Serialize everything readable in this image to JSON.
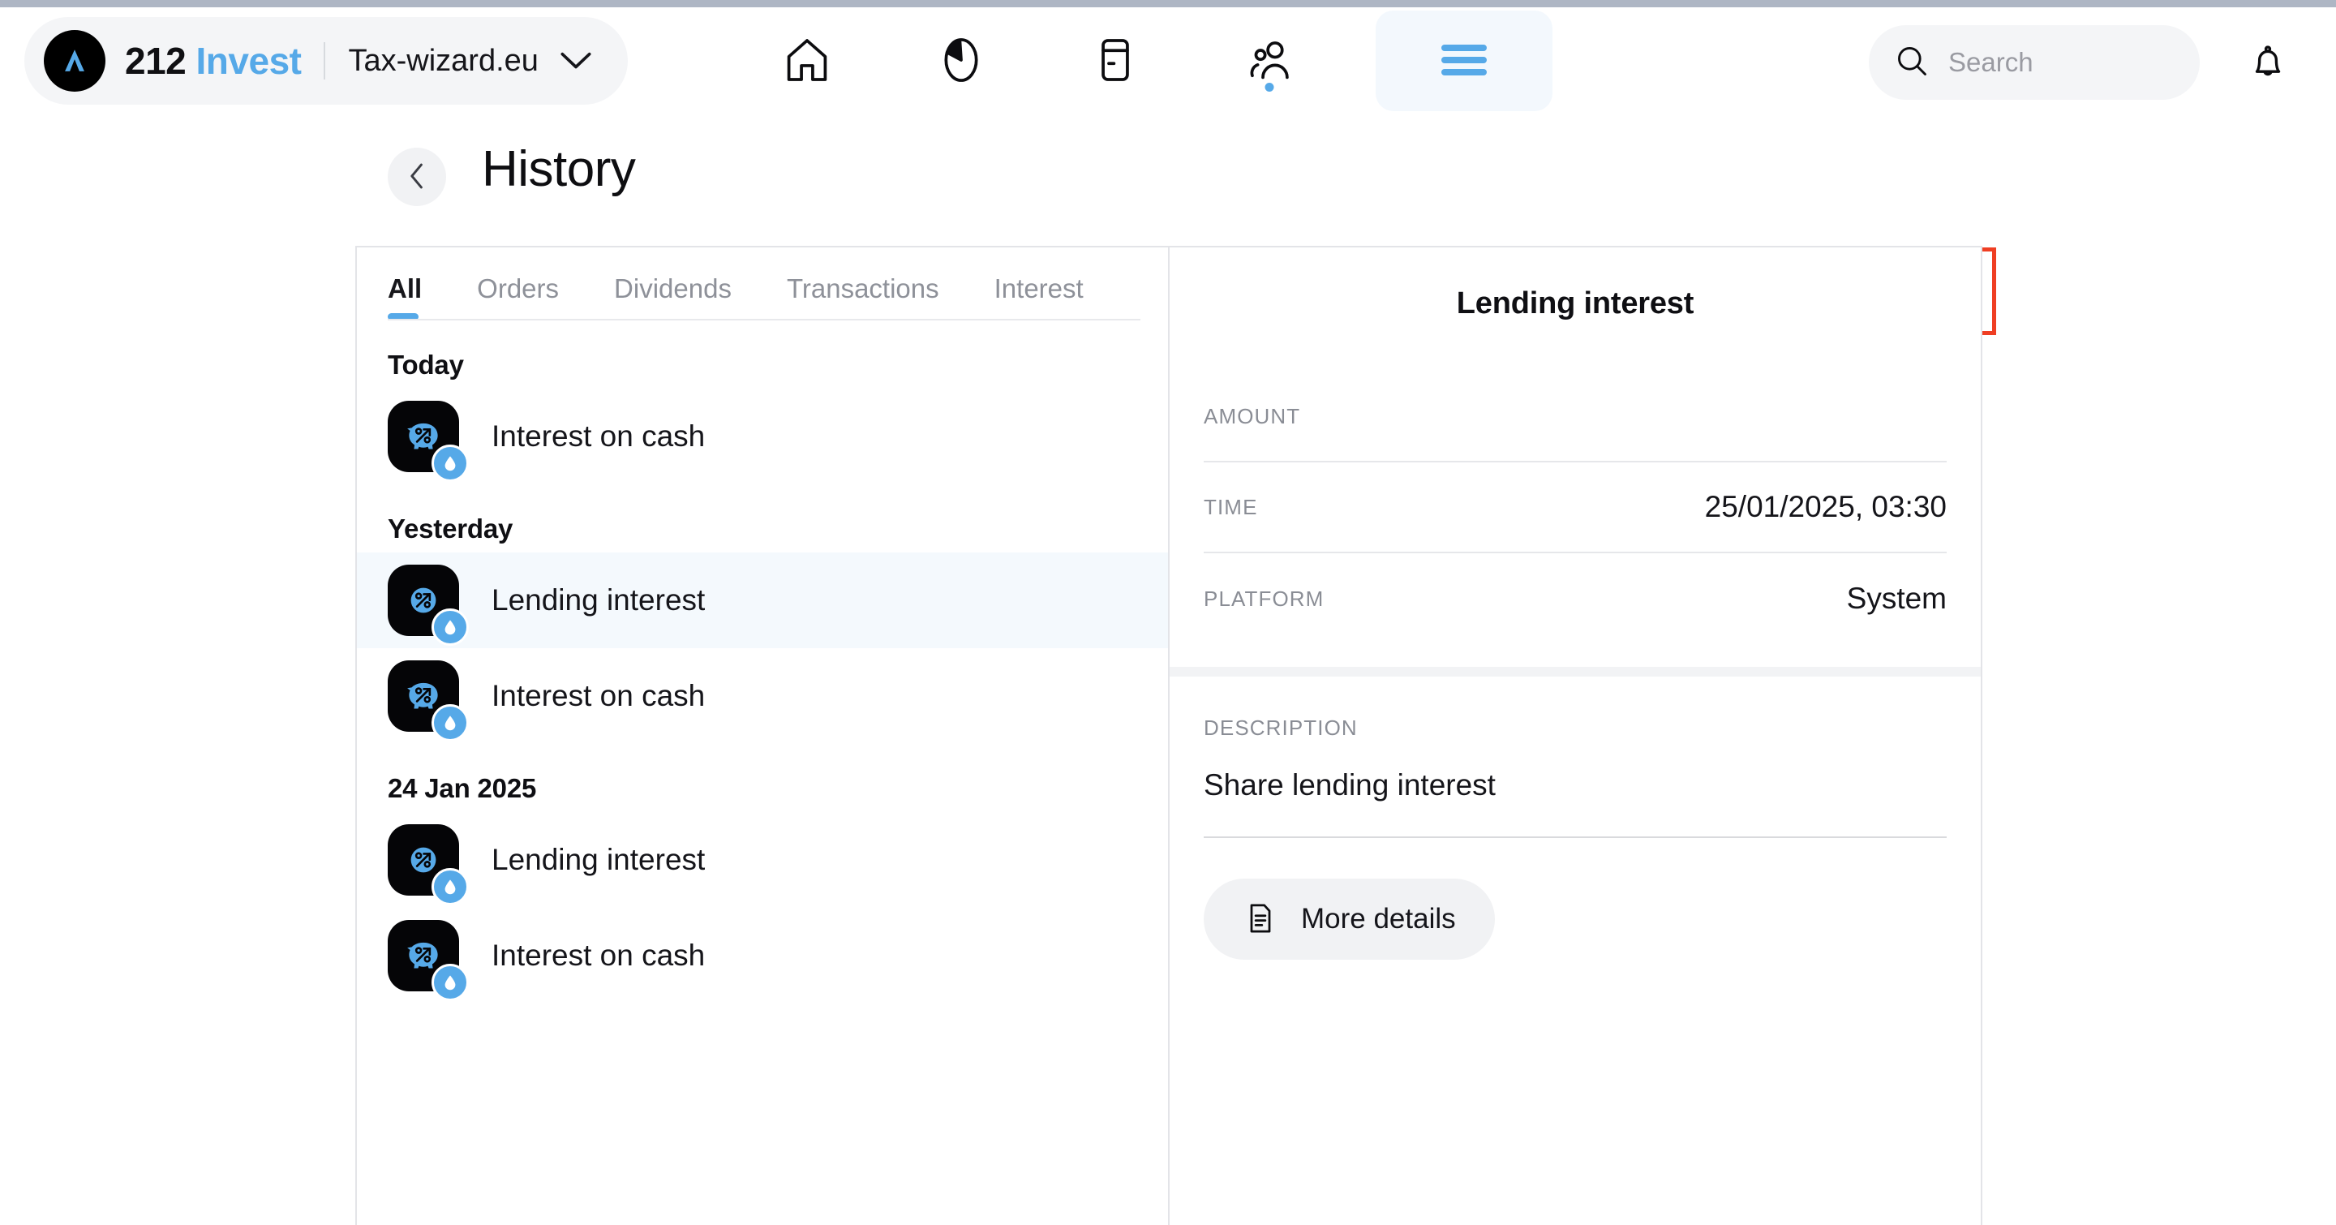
{
  "brand": {
    "logo_icon": "triangle-a-logo-icon",
    "name_prefix": "212",
    "name_accent": "Invest",
    "account": "Tax-wizard.eu",
    "caret_icon": "chevron-down-icon"
  },
  "nav": {
    "items": [
      {
        "name": "home-icon",
        "label": "Home",
        "active": false,
        "dot": false
      },
      {
        "name": "pie-chart-icon",
        "label": "Portfolio",
        "active": false,
        "dot": false
      },
      {
        "name": "card-icon",
        "label": "Card",
        "active": false,
        "dot": false
      },
      {
        "name": "people-icon",
        "label": "Community",
        "active": false,
        "dot": true
      },
      {
        "name": "hamburger-menu-icon",
        "label": "Menu",
        "active": true,
        "dot": false
      }
    ]
  },
  "search": {
    "placeholder": "Search",
    "value": "",
    "icon": "search-icon"
  },
  "notifications": {
    "icon": "bell-icon"
  },
  "page": {
    "back_icon": "chevron-left-icon",
    "title": "History",
    "export_icon": "file-download-icon",
    "highlight_color": "#ef3e23"
  },
  "tabs": [
    {
      "label": "All",
      "active": true
    },
    {
      "label": "Orders",
      "active": false
    },
    {
      "label": "Dividends",
      "active": false
    },
    {
      "label": "Transactions",
      "active": false
    },
    {
      "label": "Interest",
      "active": false
    }
  ],
  "history": {
    "groups": [
      {
        "label": "Today",
        "items": [
          {
            "label": "Interest on cash",
            "icon": "piggy-bank-percent-icon",
            "badge": "water-drop-icon",
            "selected": false
          }
        ]
      },
      {
        "label": "Yesterday",
        "items": [
          {
            "label": "Lending interest",
            "icon": "percent-circle-icon",
            "badge": "water-drop-icon",
            "selected": true
          },
          {
            "label": "Interest on cash",
            "icon": "piggy-bank-percent-icon",
            "badge": "water-drop-icon",
            "selected": false
          }
        ]
      },
      {
        "label": "24 Jan 2025",
        "items": [
          {
            "label": "Lending interest",
            "icon": "percent-circle-icon",
            "badge": "water-drop-icon",
            "selected": false
          },
          {
            "label": "Interest on cash",
            "icon": "piggy-bank-percent-icon",
            "badge": "water-drop-icon",
            "selected": false
          }
        ]
      }
    ]
  },
  "detail": {
    "title": "Lending interest",
    "rows": [
      {
        "key": "AMOUNT",
        "value": ""
      },
      {
        "key": "TIME",
        "value": "25/01/2025, 03:30"
      },
      {
        "key": "PLATFORM",
        "value": "System"
      }
    ],
    "description_key": "DESCRIPTION",
    "description_value": "Share lending interest",
    "more_details_label": "More details",
    "more_details_icon": "document-lines-icon"
  },
  "colors": {
    "accent_blue": "#56a9e8",
    "selected_row_bg": "#f4f9fd",
    "highlight_red": "#ef3e23",
    "icon_black": "#050507"
  }
}
